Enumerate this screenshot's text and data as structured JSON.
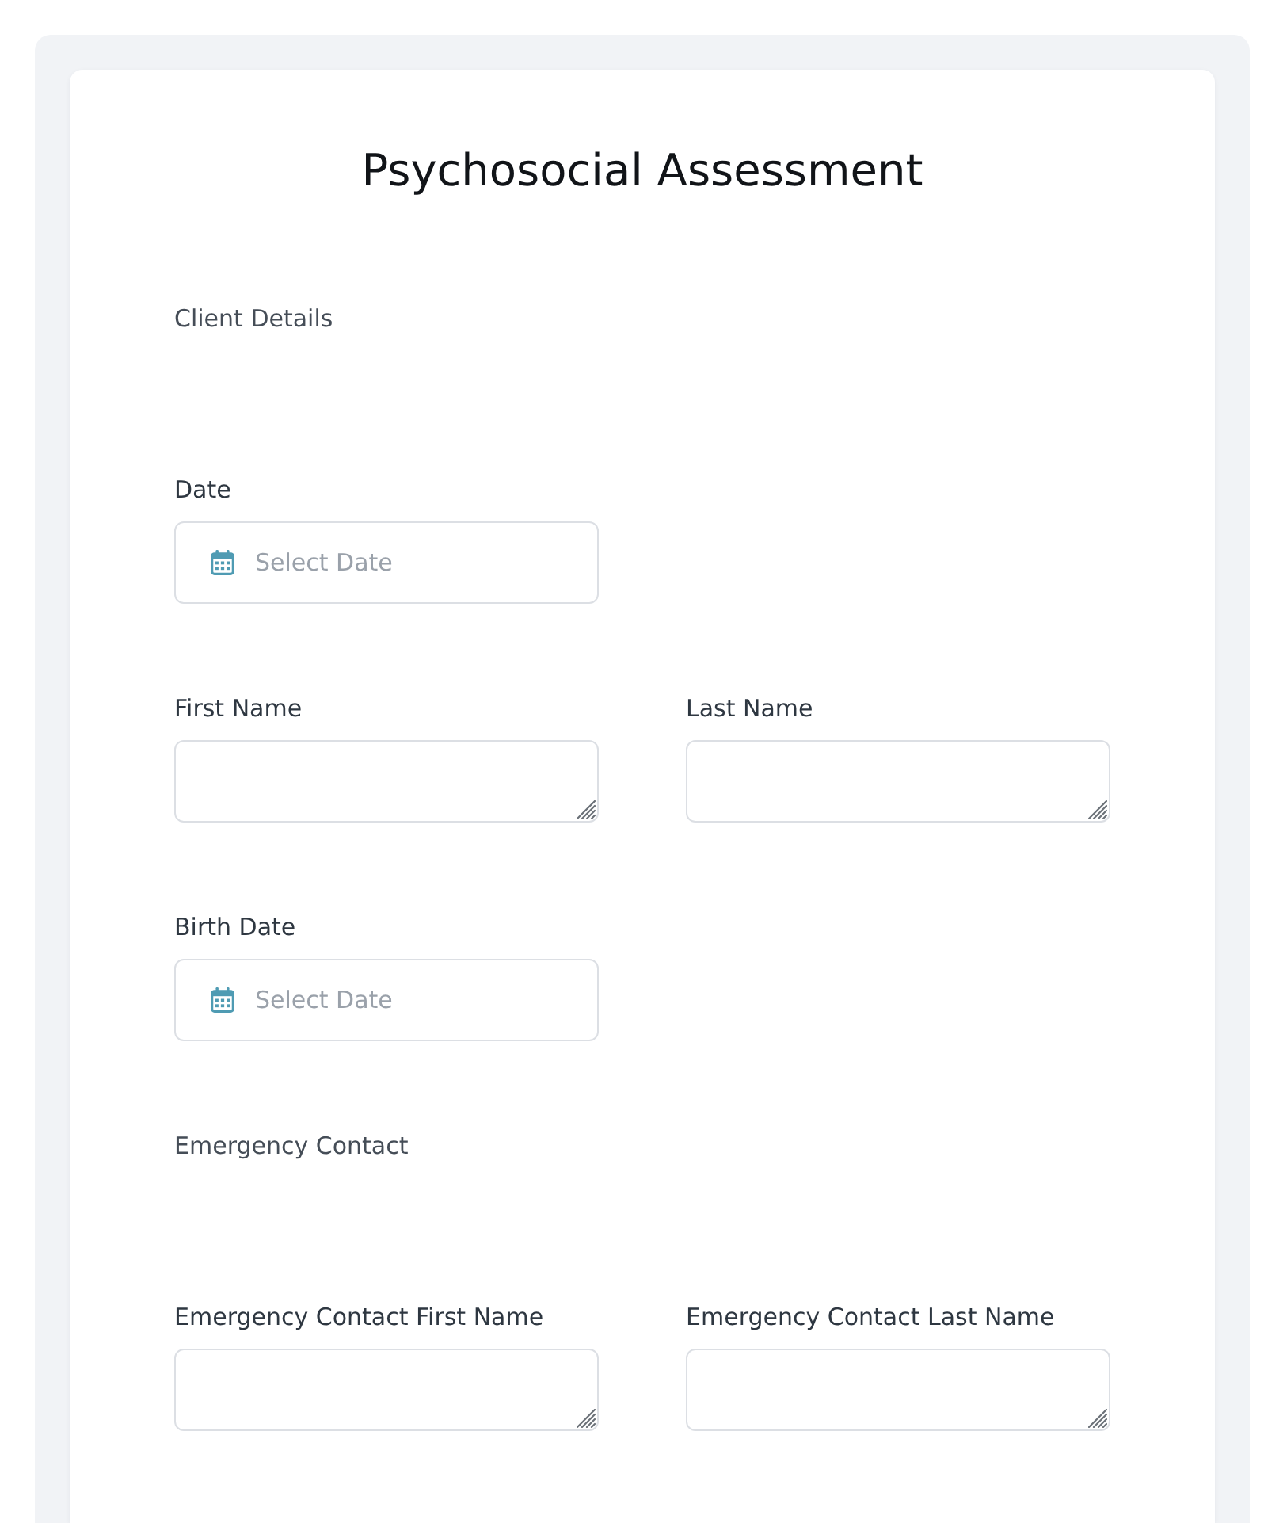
{
  "form": {
    "title": "Psychosocial Assessment",
    "items": [
      {
        "kind": "section",
        "label": "Client Details"
      },
      {
        "kind": "date",
        "label": "Date",
        "placeholder": "Select Date"
      },
      {
        "kind": "pair",
        "fields": [
          {
            "kind": "text",
            "label": "First Name"
          },
          {
            "kind": "text",
            "label": "Last Name"
          }
        ]
      },
      {
        "kind": "date",
        "label": "Birth Date",
        "placeholder": "Select Date"
      },
      {
        "kind": "section",
        "label": "Emergency Contact"
      },
      {
        "kind": "pair",
        "fields": [
          {
            "kind": "text",
            "label": "Emergency Contact First Name"
          },
          {
            "kind": "text",
            "label": "Emergency Contact Last Name"
          }
        ]
      }
    ]
  }
}
